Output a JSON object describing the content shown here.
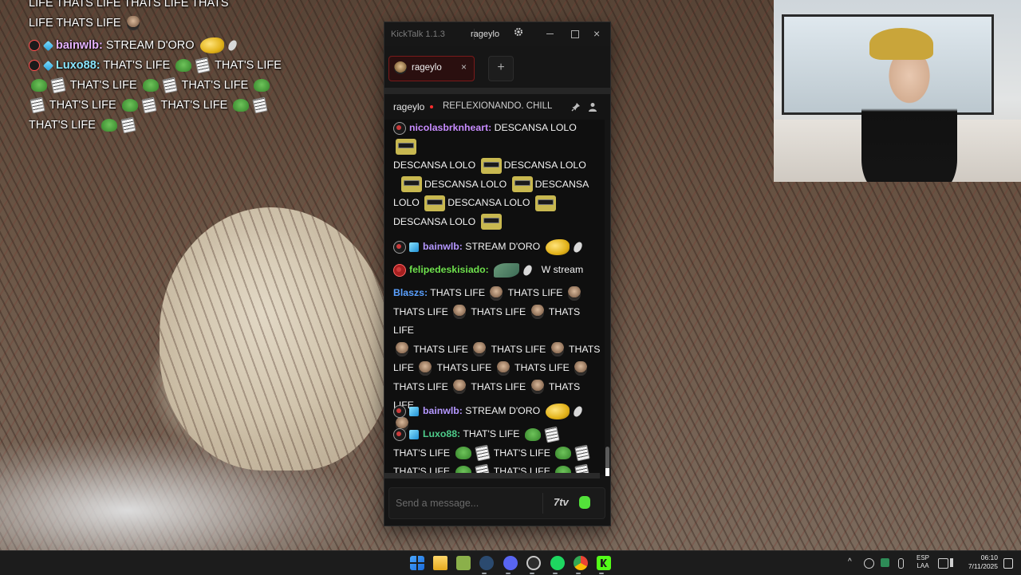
{
  "overlay_chat": {
    "line0": "LIFE   THATS LIFE   THATS LIFE   THATS",
    "line1": "LIFE   THATS LIFE",
    "msg1_user": "bainwlb:",
    "msg1_text": "STREAM D'ORO",
    "msg2_user": "Luxo88:",
    "msg2_text": "THAT'S LIFE",
    "repeat": "THAT'S LIFE"
  },
  "kicktalk": {
    "app_name": "KickTalk 1.1.3",
    "title_user": "rageylo",
    "tab_label": "rageylo",
    "add_tab": "+",
    "channel": "rageylo",
    "stream_title": "REFLEXIONANDO. CHILL",
    "input_placeholder": "Send a message...",
    "seventv_label": "7tv",
    "messages": [
      {
        "user": "nicolasbrknheart:",
        "color": "#c88cff",
        "text": "DESCANSA LOLO"
      },
      {
        "user": "bainwlb:",
        "color": "#b497ff",
        "text": "STREAM D'ORO"
      },
      {
        "user": "felipedeskisiado:",
        "color": "#6ee04c",
        "text": "W stream"
      },
      {
        "user": "Blaszs:",
        "color": "#5aa0ff",
        "text": "THATS LIFE"
      },
      {
        "user": "bainwlb:",
        "color": "#b497ff",
        "text": "STREAM D'ORO"
      },
      {
        "user": "Luxo88:",
        "color": "#4ecb8a",
        "text": "THAT'S LIFE"
      }
    ],
    "phrases": {
      "descansa": "DESCANSA LOLO",
      "descansa_a": "DESCANSA",
      "descansa_b": "LOLO",
      "thats_life": "THATS LIFE",
      "thats": "THATS",
      "life": "LIFE",
      "thats_life_apos": "THAT'S LIFE"
    }
  },
  "taskbar": {
    "lang_line1": "ESP",
    "lang_line2": "LAA",
    "time": "06:10",
    "date": "7/11/2025",
    "chevron": "^"
  }
}
